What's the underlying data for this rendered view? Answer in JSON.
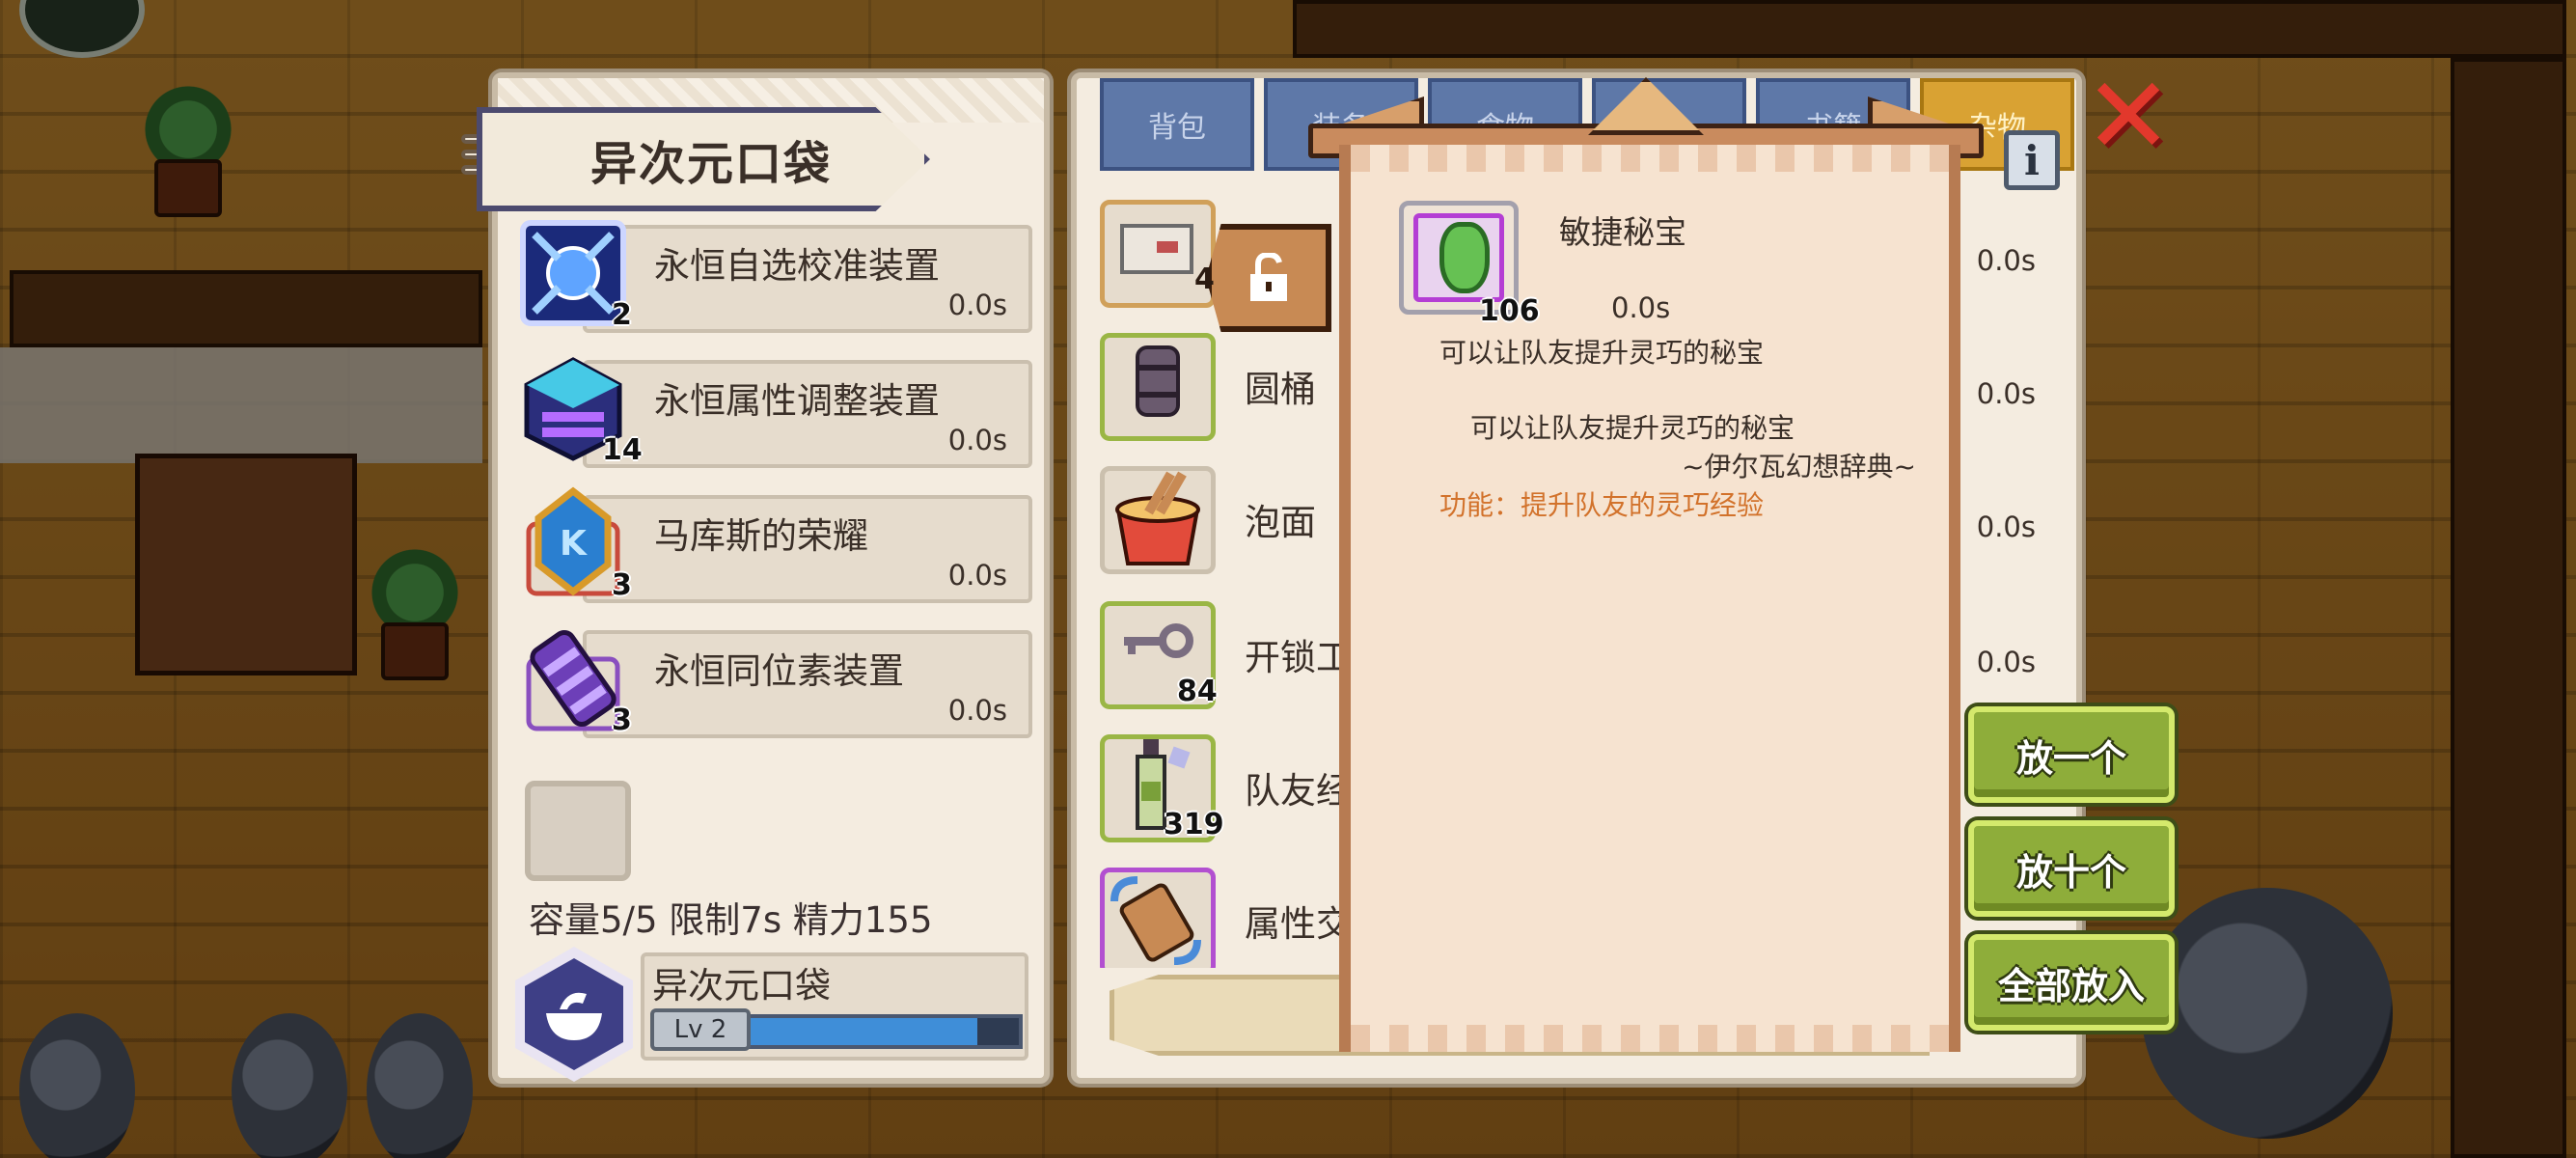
{
  "left_panel": {
    "title": "异次元口袋",
    "items": [
      {
        "name": "永恒自选校准装置",
        "time": "0.0s",
        "count": "2",
        "icon": "blue-device-icon"
      },
      {
        "name": "永恒属性调整装置",
        "time": "0.0s",
        "count": "14",
        "icon": "cube-device-icon"
      },
      {
        "name": "马库斯的荣耀",
        "time": "0.0s",
        "count": "3",
        "icon": "crystal-emblem-icon"
      },
      {
        "name": "永恒同位素装置",
        "time": "0.0s",
        "count": "3",
        "icon": "isotope-device-icon"
      }
    ],
    "capacity_text": "容量5/5 限制7s 精力155",
    "pouch": {
      "name": "异次元口袋",
      "level": "Lv 2",
      "xp_fraction": 0.85
    }
  },
  "right_panel": {
    "tabs": [
      {
        "label": "背包",
        "active": false
      },
      {
        "label": "装备",
        "active": false
      },
      {
        "label": "食物",
        "active": false
      },
      {
        "label": "",
        "active": false
      },
      {
        "label": "书籍",
        "active": false
      },
      {
        "label": "杂物",
        "active": true
      }
    ],
    "locked_count": "4",
    "items": [
      {
        "name": "",
        "time": "0.0s",
        "count": "",
        "icon": "letter-icon"
      },
      {
        "name": "圆桶",
        "time": "0.0s",
        "count": "",
        "icon": "barrel-icon"
      },
      {
        "name": "泡面",
        "time": "0.0s",
        "count": "",
        "icon": "noodle-cup-icon"
      },
      {
        "name": "开锁工",
        "time": "0.0s",
        "count": "84",
        "icon": "key-icon"
      },
      {
        "name": "队友经",
        "time": "",
        "count": "319",
        "icon": "bottle-icon"
      },
      {
        "name": "属性交",
        "time": "",
        "count": "",
        "icon": "scroll-swap-icon"
      }
    ]
  },
  "tooltip": {
    "name": "敏捷秘宝",
    "count": "106",
    "time": "0.0s",
    "short_desc": "可以让队友提升灵巧的秘宝",
    "desc": "可以让队友提升灵巧的秘宝",
    "source": "~伊尔瓦幻想辞典~",
    "function": "功能：提升队友的灵巧经验"
  },
  "actions": {
    "put_one": "放一个",
    "put_ten": "放十个",
    "put_all": "全部放入"
  },
  "colors": {
    "accent_green": "#8ead3a",
    "tab_blue": "#5e78a8",
    "tab_active": "#d9a233",
    "function_orange": "#d2722b",
    "close_red": "#e2382c"
  }
}
